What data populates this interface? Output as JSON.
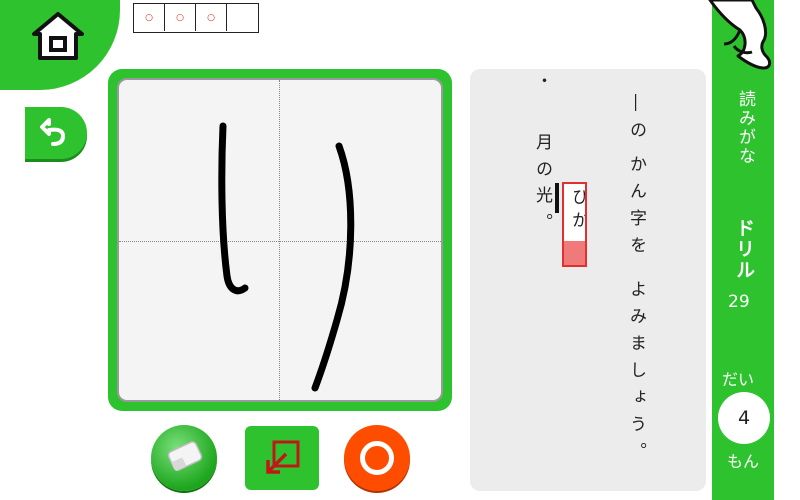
{
  "header": {
    "answer_boxes": [
      "○",
      "○",
      "○",
      ""
    ]
  },
  "question": {
    "lines": [
      "―の",
      "かん字を",
      "よみましょう。"
    ],
    "sentence_lines": [
      "・",
      "月の",
      "光。"
    ],
    "reading": "ひか",
    "reading_progress": 0.3
  },
  "sidebar": {
    "yomigana": "読みがな",
    "drill_label": "ドリル",
    "drill_number": "29",
    "dai_label": "だい",
    "question_number": "4",
    "mon_label": "もん"
  },
  "canvas": {
    "written_char": "り",
    "stroke_color": "#000000"
  },
  "colors": {
    "accent_green": "#2ec22e",
    "ok_orange": "#ff4d00",
    "highlight_red": "#e03030"
  },
  "icons": [
    "home-icon",
    "back-arrow-icon",
    "eraser-icon",
    "resize-icon",
    "ok-circle-icon",
    "pointing-hand-icon"
  ]
}
